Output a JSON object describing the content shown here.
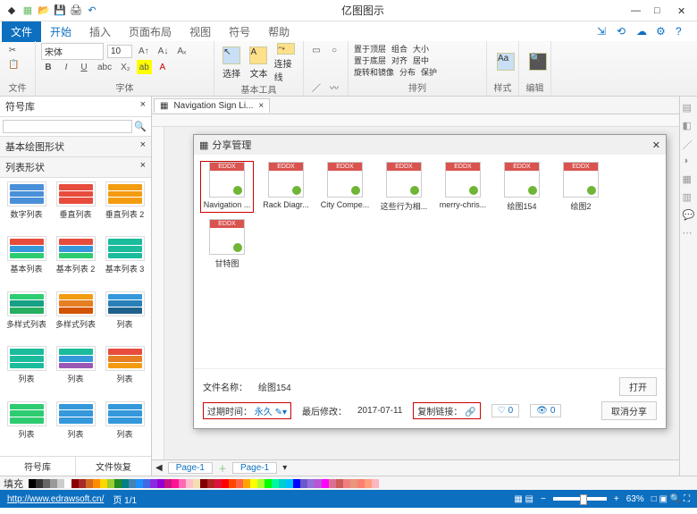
{
  "app_title": "亿图图示",
  "menu": {
    "file": "文件",
    "tabs": [
      "开始",
      "插入",
      "页面布局",
      "视图",
      "符号",
      "帮助"
    ],
    "active": 0
  },
  "ribbon": {
    "font_name": "宋体",
    "font_size": "10",
    "groups": {
      "file": "文件",
      "font": "字体",
      "basic_tools": "基本工具",
      "arrange": "排列",
      "style": "样式",
      "edit": "编辑"
    },
    "tools": {
      "select": "选择",
      "text": "文本",
      "connector": "连接线"
    },
    "arrange": {
      "bring_front": "置于顶层",
      "send_back": "置于底层",
      "rotate": "旋转和镜像",
      "group": "组合",
      "align": "对齐",
      "distribute": "分布",
      "size": "大小",
      "center": "居中",
      "lock": "保护"
    }
  },
  "sidebar": {
    "title": "符号库",
    "basic_shapes": "基本绘图形状",
    "list_shapes": "列表形状",
    "shapes": [
      "数字列表",
      "垂直列表",
      "垂直列表 2",
      "基本列表",
      "基本列表 2",
      "基本列表 3",
      "多样式列表",
      "多样式列表",
      "列表",
      "列表",
      "列表",
      "列表",
      "列表",
      "列表",
      "列表"
    ],
    "bottom": {
      "shapes": "符号库",
      "recover": "文件恢复"
    }
  },
  "doc_tab": "Navigation Sign Li...",
  "dialog": {
    "title": "分享管理",
    "files": [
      "Navigation ...",
      "Rack Diagr...",
      "City Compe...",
      "这些行为相...",
      "merry-chris...",
      "绘图154",
      "绘图2",
      "甘特图"
    ],
    "file_name_label": "文件名称：",
    "file_name": "绘图154",
    "expire_label": "过期时间：",
    "expire_val": "永久",
    "modified_label": "最后修改：",
    "modified_val": "2017-07-11",
    "copy_link": "复制链接：",
    "likes": "0",
    "views": "0",
    "open": "打开",
    "cancel_share": "取消分享"
  },
  "page_tabs": {
    "page1": "Page-1"
  },
  "colorbar_label": "填充",
  "status": {
    "url": "http://www.edrawsoft.cn/",
    "page": "页 1/1",
    "zoom": "63%"
  }
}
